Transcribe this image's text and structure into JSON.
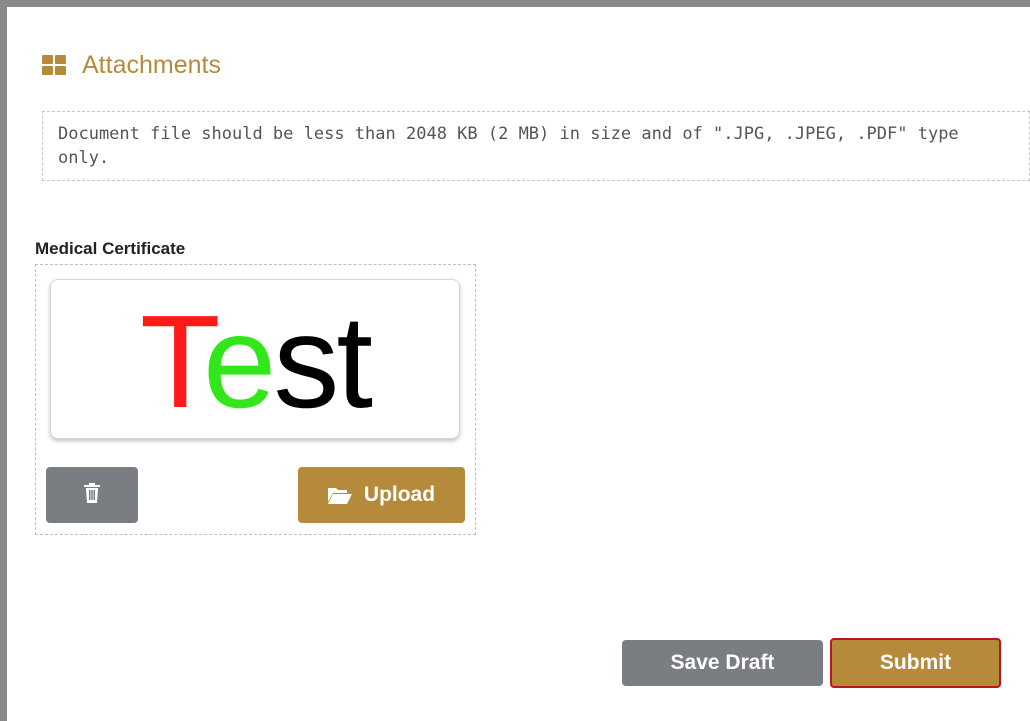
{
  "section": {
    "title": "Attachments",
    "icon": "grid-icon",
    "accent_color": "#b58a3b"
  },
  "notice": {
    "text": "Document file should be less than 2048 KB (2 MB) in size and of \".JPG, .JPEG, .PDF\" type only."
  },
  "attachment": {
    "label": "Medical Certificate",
    "preview": {
      "parts": [
        {
          "text": "T",
          "color": "#ff1a1a"
        },
        {
          "text": "e",
          "color": "#33e61a"
        },
        {
          "text": "st",
          "color": "#000000"
        }
      ]
    },
    "delete_icon": "trash-icon",
    "upload_icon": "folder-open-icon",
    "upload_label": "Upload"
  },
  "actions": {
    "save_draft_label": "Save Draft",
    "submit_label": "Submit"
  },
  "colors": {
    "primary": "#b58a3b",
    "secondary": "#7a7e82",
    "focus_border": "#c0121f"
  }
}
